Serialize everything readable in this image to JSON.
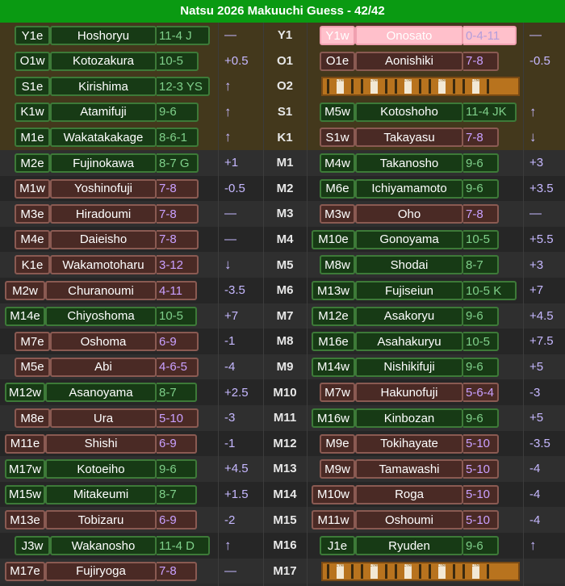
{
  "title": "Natsu 2026 Makuuchi Guess - 42/42",
  "mystery_text": "CYMO",
  "rows": [
    {
      "rank": "Y1",
      "bg": "sanyaku",
      "east": {
        "code": "Y1e",
        "name": "Hoshoryu",
        "rec": "11-4 J",
        "style": "g"
      },
      "ed": "—",
      "west": {
        "code": "Y1w",
        "name": "Onosato",
        "rec": "0-4-11",
        "style": "p"
      },
      "wd": "—"
    },
    {
      "rank": "O1",
      "bg": "sanyaku",
      "east": {
        "code": "O1w",
        "name": "Kotozakura",
        "rec": "10-5",
        "style": "g"
      },
      "ed": "+0.5",
      "west": {
        "code": "O1e",
        "name": "Aonishiki",
        "rec": "7-8",
        "style": "b"
      },
      "wd": "-0.5"
    },
    {
      "rank": "O2",
      "bg": "sanyaku",
      "east": {
        "code": "S1e",
        "name": "Kirishima",
        "rec": "12-3 YS",
        "style": "g"
      },
      "ed": "↑",
      "west": null,
      "wd": ""
    },
    {
      "rank": "S1",
      "bg": "sanyaku",
      "east": {
        "code": "K1w",
        "name": "Atamifuji",
        "rec": "9-6",
        "style": "g"
      },
      "ed": "↑",
      "west": {
        "code": "M5w",
        "name": "Kotoshoho",
        "rec": "11-4 JK",
        "style": "g"
      },
      "wd": "↑"
    },
    {
      "rank": "K1",
      "bg": "sanyaku",
      "east": {
        "code": "M1e",
        "name": "Wakatakakage",
        "rec": "8-6-1",
        "style": "g"
      },
      "ed": "↑",
      "west": {
        "code": "S1w",
        "name": "Takayasu",
        "rec": "7-8",
        "style": "b"
      },
      "wd": "↓"
    },
    {
      "rank": "M1",
      "bg": "alt",
      "east": {
        "code": "M2e",
        "name": "Fujinokawa",
        "rec": "8-7 G",
        "style": "g"
      },
      "ed": "+1",
      "west": {
        "code": "M4w",
        "name": "Takanosho",
        "rec": "9-6",
        "style": "g"
      },
      "wd": "+3"
    },
    {
      "rank": "M2",
      "bg": "base",
      "east": {
        "code": "M1w",
        "name": "Yoshinofuji",
        "rec": "7-8",
        "style": "b"
      },
      "ed": "-0.5",
      "west": {
        "code": "M6e",
        "name": "Ichiyamamoto",
        "rec": "9-6",
        "style": "g"
      },
      "wd": "+3.5"
    },
    {
      "rank": "M3",
      "bg": "alt",
      "east": {
        "code": "M3e",
        "name": "Hiradoumi",
        "rec": "7-8",
        "style": "b"
      },
      "ed": "—",
      "west": {
        "code": "M3w",
        "name": "Oho",
        "rec": "7-8",
        "style": "b"
      },
      "wd": "—"
    },
    {
      "rank": "M4",
      "bg": "base",
      "east": {
        "code": "M4e",
        "name": "Daieisho",
        "rec": "7-8",
        "style": "b"
      },
      "ed": "—",
      "west": {
        "code": "M10e",
        "name": "Gonoyama",
        "rec": "10-5",
        "style": "g"
      },
      "wd": "+5.5"
    },
    {
      "rank": "M5",
      "bg": "alt",
      "east": {
        "code": "K1e",
        "name": "Wakamotoharu",
        "rec": "3-12",
        "style": "b"
      },
      "ed": "↓",
      "west": {
        "code": "M8w",
        "name": "Shodai",
        "rec": "8-7",
        "style": "g"
      },
      "wd": "+3"
    },
    {
      "rank": "M6",
      "bg": "base",
      "east": {
        "code": "M2w",
        "name": "Churanoumi",
        "rec": "4-11",
        "style": "b"
      },
      "ed": "-3.5",
      "west": {
        "code": "M13w",
        "name": "Fujiseiun",
        "rec": "10-5 K",
        "style": "g"
      },
      "wd": "+7"
    },
    {
      "rank": "M7",
      "bg": "alt",
      "east": {
        "code": "M14e",
        "name": "Chiyoshoma",
        "rec": "10-5",
        "style": "g"
      },
      "ed": "+7",
      "west": {
        "code": "M12e",
        "name": "Asakoryu",
        "rec": "9-6",
        "style": "g"
      },
      "wd": "+4.5"
    },
    {
      "rank": "M8",
      "bg": "base",
      "east": {
        "code": "M7e",
        "name": "Oshoma",
        "rec": "6-9",
        "style": "b"
      },
      "ed": "-1",
      "west": {
        "code": "M16e",
        "name": "Asahakuryu",
        "rec": "10-5",
        "style": "g"
      },
      "wd": "+7.5"
    },
    {
      "rank": "M9",
      "bg": "alt",
      "east": {
        "code": "M5e",
        "name": "Abi",
        "rec": "4-6-5",
        "style": "b"
      },
      "ed": "-4",
      "west": {
        "code": "M14w",
        "name": "Nishikifuji",
        "rec": "9-6",
        "style": "g"
      },
      "wd": "+5"
    },
    {
      "rank": "M10",
      "bg": "base",
      "east": {
        "code": "M12w",
        "name": "Asanoyama",
        "rec": "8-7",
        "style": "g"
      },
      "ed": "+2.5",
      "west": {
        "code": "M7w",
        "name": "Hakunofuji",
        "rec": "5-6-4",
        "style": "b"
      },
      "wd": "-3"
    },
    {
      "rank": "M11",
      "bg": "alt",
      "east": {
        "code": "M8e",
        "name": "Ura",
        "rec": "5-10",
        "style": "b"
      },
      "ed": "-3",
      "west": {
        "code": "M16w",
        "name": "Kinbozan",
        "rec": "9-6",
        "style": "g"
      },
      "wd": "+5"
    },
    {
      "rank": "M12",
      "bg": "base",
      "east": {
        "code": "M11e",
        "name": "Shishi",
        "rec": "6-9",
        "style": "b"
      },
      "ed": "-1",
      "west": {
        "code": "M9e",
        "name": "Tokihayate",
        "rec": "5-10",
        "style": "b"
      },
      "wd": "-3.5"
    },
    {
      "rank": "M13",
      "bg": "alt",
      "east": {
        "code": "M17w",
        "name": "Kotoeiho",
        "rec": "9-6",
        "style": "g"
      },
      "ed": "+4.5",
      "west": {
        "code": "M9w",
        "name": "Tamawashi",
        "rec": "5-10",
        "style": "b"
      },
      "wd": "-4"
    },
    {
      "rank": "M14",
      "bg": "base",
      "east": {
        "code": "M15w",
        "name": "Mitakeumi",
        "rec": "8-7",
        "style": "g"
      },
      "ed": "+1.5",
      "west": {
        "code": "M10w",
        "name": "Roga",
        "rec": "5-10",
        "style": "b"
      },
      "wd": "-4"
    },
    {
      "rank": "M15",
      "bg": "alt",
      "east": {
        "code": "M13e",
        "name": "Tobizaru",
        "rec": "6-9",
        "style": "b"
      },
      "ed": "-2",
      "west": {
        "code": "M11w",
        "name": "Oshoumi",
        "rec": "5-10",
        "style": "b"
      },
      "wd": "-4"
    },
    {
      "rank": "M16",
      "bg": "base",
      "east": {
        "code": "J3w",
        "name": "Wakanosho",
        "rec": "11-4 D",
        "style": "g"
      },
      "ed": "↑",
      "west": {
        "code": "J1e",
        "name": "Ryuden",
        "rec": "9-6",
        "style": "g"
      },
      "wd": "↑"
    },
    {
      "rank": "M17",
      "bg": "alt",
      "east": {
        "code": "M17e",
        "name": "Fujiryoga",
        "rec": "7-8",
        "style": "b"
      },
      "ed": "—",
      "west": null,
      "wd": ""
    }
  ]
}
